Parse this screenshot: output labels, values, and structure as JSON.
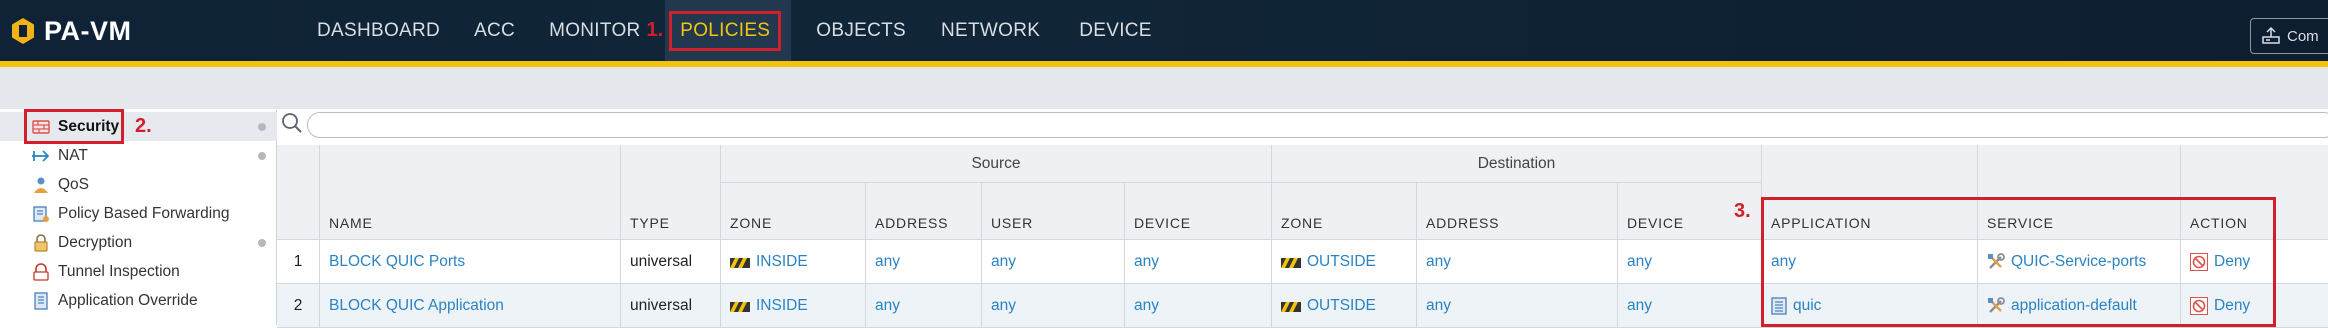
{
  "app": {
    "title": "PA-VM"
  },
  "nav": {
    "items": [
      "DASHBOARD",
      "ACC",
      "MONITOR",
      "POLICIES",
      "OBJECTS",
      "NETWORK",
      "DEVICE"
    ],
    "active": "POLICIES",
    "step_label": "1."
  },
  "commit": {
    "label": "Com"
  },
  "sidebar": {
    "items": [
      {
        "label": "Security",
        "icon": "security-rule-icon",
        "selected": true,
        "dot": true
      },
      {
        "label": "NAT",
        "icon": "nat-arrow-icon",
        "dot": true
      },
      {
        "label": "QoS",
        "icon": "qos-icon"
      },
      {
        "label": "Policy Based Forwarding",
        "icon": "pbf-icon"
      },
      {
        "label": "Decryption",
        "icon": "lock-icon",
        "dot": true
      },
      {
        "label": "Tunnel Inspection",
        "icon": "tunnel-icon"
      },
      {
        "label": "Application Override",
        "icon": "app-override-icon"
      }
    ],
    "step_label": "2."
  },
  "search": {
    "value": "",
    "placeholder": ""
  },
  "table": {
    "groups": {
      "source": "Source",
      "destination": "Destination"
    },
    "columns": [
      "NAME",
      "TYPE",
      "ZONE",
      "ADDRESS",
      "USER",
      "DEVICE",
      "ZONE",
      "ADDRESS",
      "DEVICE",
      "APPLICATION",
      "SERVICE",
      "ACTION"
    ],
    "rows": [
      {
        "num": "1",
        "name": "BLOCK QUIC Ports",
        "type": "universal",
        "src_zone": "INSIDE",
        "src_address": "any",
        "src_user": "any",
        "src_device": "any",
        "dst_zone": "OUTSIDE",
        "dst_address": "any",
        "dst_device": "any",
        "application": "any",
        "service": "QUIC-Service-ports",
        "action": "Deny"
      },
      {
        "num": "2",
        "name": "BLOCK QUIC Application",
        "type": "universal",
        "src_zone": "INSIDE",
        "src_address": "any",
        "src_user": "any",
        "src_device": "any",
        "dst_zone": "OUTSIDE",
        "dst_address": "any",
        "dst_device": "any",
        "application": "quic",
        "service": "application-default",
        "action": "Deny"
      }
    ],
    "step_label": "3."
  },
  "colors": {
    "accent": "#f3c20a",
    "link": "#2a83c2",
    "annotation": "#d21f2b",
    "topbar": "#0f2236"
  }
}
